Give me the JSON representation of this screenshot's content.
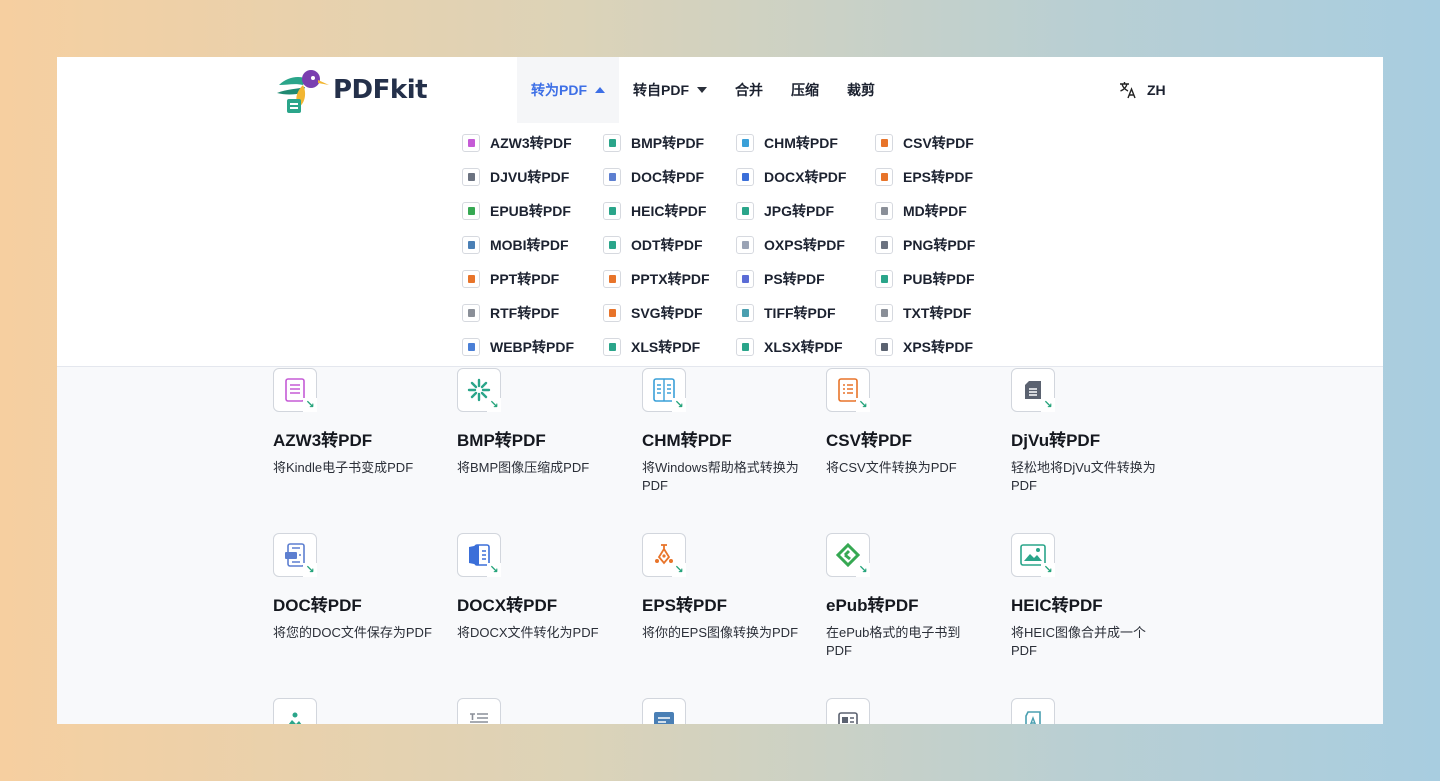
{
  "brand": {
    "name": "PDFkit"
  },
  "nav": [
    {
      "label": "转为PDF",
      "caret": "up",
      "active": true
    },
    {
      "label": "转自PDF",
      "caret": "down",
      "active": false
    },
    {
      "label": "合并"
    },
    {
      "label": "压缩"
    },
    {
      "label": "裁剪"
    }
  ],
  "lang": {
    "label": "ZH",
    "icon": "translate-icon"
  },
  "dropdown": {
    "columns": [
      [
        {
          "label": "AZW3转PDF",
          "color": "#c55bd6"
        },
        {
          "label": "DJVU转PDF",
          "color": "#6b7280"
        },
        {
          "label": "EPUB转PDF",
          "color": "#36a852"
        },
        {
          "label": "MOBI转PDF",
          "color": "#4a7fb5"
        },
        {
          "label": "PPT转PDF",
          "color": "#e8742a"
        },
        {
          "label": "RTF转PDF",
          "color": "#8a8f98"
        },
        {
          "label": "WEBP转PDF",
          "color": "#4a7fd6"
        }
      ],
      [
        {
          "label": "BMP转PDF",
          "color": "#2aa58a"
        },
        {
          "label": "DOC转PDF",
          "color": "#5d7fd0"
        },
        {
          "label": "HEIC转PDF",
          "color": "#2aa58a"
        },
        {
          "label": "ODT转PDF",
          "color": "#2aa58a"
        },
        {
          "label": "PPTX转PDF",
          "color": "#e8742a"
        },
        {
          "label": "SVG转PDF",
          "color": "#e8742a"
        },
        {
          "label": "XLS转PDF",
          "color": "#2aa58a"
        }
      ],
      [
        {
          "label": "CHM转PDF",
          "color": "#3aa0d8"
        },
        {
          "label": "DOCX转PDF",
          "color": "#3b6fd9"
        },
        {
          "label": "JPG转PDF",
          "color": "#2aa58a"
        },
        {
          "label": "OXPS转PDF",
          "color": "#9aa3b5"
        },
        {
          "label": "PS转PDF",
          "color": "#5b6cd6"
        },
        {
          "label": "TIFF转PDF",
          "color": "#4a9fb0"
        },
        {
          "label": "XLSX转PDF",
          "color": "#2aa58a"
        }
      ],
      [
        {
          "label": "CSV转PDF",
          "color": "#e8742a"
        },
        {
          "label": "EPS转PDF",
          "color": "#e8742a"
        },
        {
          "label": "MD转PDF",
          "color": "#8a8f98"
        },
        {
          "label": "PNG转PDF",
          "color": "#6b7280"
        },
        {
          "label": "PUB转PDF",
          "color": "#2aa58a"
        },
        {
          "label": "TXT转PDF",
          "color": "#8a8f98"
        },
        {
          "label": "XPS转PDF",
          "color": "#5b6270"
        }
      ]
    ]
  },
  "cards": [
    {
      "title": "AZW3转PDF",
      "desc": "将Kindle电子书变成PDF",
      "icon": "book-icon",
      "color": "#c55bd6"
    },
    {
      "title": "BMP转PDF",
      "desc": "将BMP图像压缩成PDF",
      "icon": "snowflake-icon",
      "color": "#2aa58a"
    },
    {
      "title": "CHM转PDF",
      "desc": "将Windows帮助格式转换为PDF",
      "icon": "help-book-icon",
      "color": "#3aa0d8"
    },
    {
      "title": "CSV转PDF",
      "desc": "将CSV文件转换为PDF",
      "icon": "list-icon",
      "color": "#e8742a"
    },
    {
      "title": "DjVu转PDF",
      "desc": "轻松地将DjVu文件转换为PDF",
      "icon": "document-icon",
      "color": "#5b6270"
    },
    {
      "title": "DOC转PDF",
      "desc": "将您的DOC文件保存为PDF",
      "icon": "doc-icon",
      "color": "#5d7fd0"
    },
    {
      "title": "DOCX转PDF",
      "desc": "将DOCX文件转化为PDF",
      "icon": "docx-icon",
      "color": "#3b6fd9"
    },
    {
      "title": "EPS转PDF",
      "desc": "将你的EPS图像转换为PDF",
      "icon": "pen-nib-icon",
      "color": "#e8742a"
    },
    {
      "title": "ePub转PDF",
      "desc": "在ePub格式的电子书到PDF",
      "icon": "epub-icon",
      "color": "#36a852"
    },
    {
      "title": "HEIC转PDF",
      "desc": "将HEIC图像合并成一个PDF",
      "icon": "image-icon",
      "color": "#2aa58a"
    },
    {
      "title": "",
      "desc": "",
      "icon": "jpg-image-icon",
      "color": "#2aa58a"
    },
    {
      "title": "",
      "desc": "",
      "icon": "markdown-icon",
      "color": "#8a8f98"
    },
    {
      "title": "",
      "desc": "",
      "icon": "mobi-icon",
      "color": "#4a7fb5"
    },
    {
      "title": "",
      "desc": "",
      "icon": "odt-icon",
      "color": "#5b6270"
    },
    {
      "title": "",
      "desc": "",
      "icon": "oxps-icon",
      "color": "#4a9fb0"
    }
  ]
}
